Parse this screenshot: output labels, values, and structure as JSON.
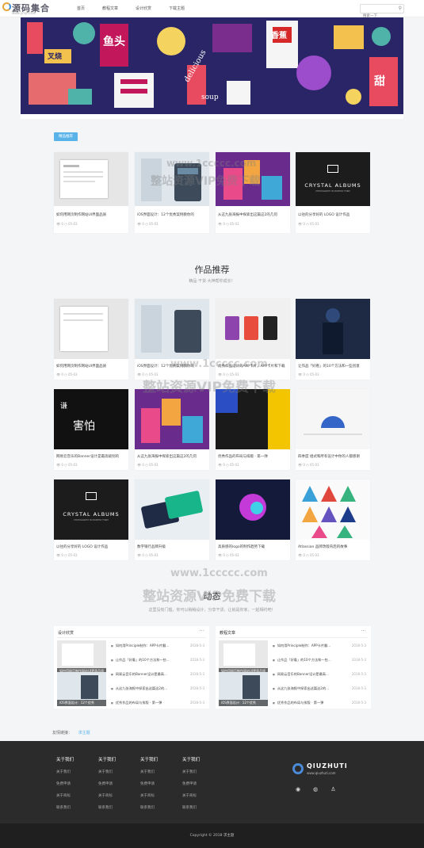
{
  "header": {
    "logo_text": "源码集合",
    "logo_sub": "www.ymjh.com",
    "nav": [
      "首页",
      "教程文章",
      "设计欣赏",
      "下载主题"
    ],
    "search_placeholder": "搜索一下"
  },
  "banner": {
    "texts": [
      "delicious",
      "soup",
      "鱼头",
      "叉烧",
      "香蕉",
      "甜"
    ]
  },
  "tag_button": "精品推荐",
  "featured": [
    {
      "title": "如何用网页制作网站UI界面品质",
      "views": "0",
      "date": "05-03"
    },
    {
      "title": "iOS界面设计：12个优秀案例教你的",
      "views": "0",
      "date": "05-03"
    },
    {
      "title": "从这九张海报中探索出这篇这2的几何",
      "views": "0",
      "date": "05-03"
    },
    {
      "title": "以往的分享好的 LOGO 设计作品",
      "views": "0",
      "date": "05-03"
    }
  ],
  "works": {
    "title": "作品推荐",
    "subtitle": "精品·干货·大神帮你成长！",
    "rows": [
      [
        {
          "title": "如何用网页制作网站UI界面品质",
          "views": "0",
          "date": "05-03"
        },
        {
          "title": "iOS界面设计：12个优秀案例教你的",
          "views": "0",
          "date": "05-03"
        },
        {
          "title": "优秀作品设计的APP卡片，APP卡片和下载",
          "views": "0",
          "date": "05-03"
        },
        {
          "title": "让作品「好看」的10个方法和一些创意",
          "views": "0",
          "date": "05-03"
        }
      ],
      [
        {
          "title": "网易云音乐的Banner设计是最高级别的",
          "views": "0",
          "date": "05-03"
        },
        {
          "title": "从这九张海报中探索出这篇这2的几何",
          "views": "0",
          "date": "05-03"
        },
        {
          "title": "优秀作品的布局与排版 · 第一弹",
          "views": "0",
          "date": "05-03"
        },
        {
          "title": "四季度 组式和所有设计中你的人都感谢",
          "views": "0",
          "date": "05-03"
        }
      ],
      [
        {
          "title": "以往的分享好的 LOGO 设计作品",
          "views": "0",
          "date": "05-03"
        },
        {
          "title": "数字银行品牌升级",
          "views": "0",
          "date": "05-03"
        },
        {
          "title": "高质感的logo的制作趋势下载",
          "views": "0",
          "date": "05-03"
        },
        {
          "title": "Atlassian 品牌改版背后的故事",
          "views": "0",
          "date": "05-03"
        }
      ]
    ],
    "thumb_texts": {
      "crystal": "CRYSTAL ALBUMS",
      "crystal_sub": "PHOTOGRAPHY IN MONTHLY FORM",
      "qian": "谦",
      "haipa": "害怕"
    }
  },
  "dynamic": {
    "title": "动态",
    "subtitle": "这里没有门槛，你可以稍稍设计，分享干货，让就是你家，一起相约吧！",
    "boxes": [
      {
        "title": "设计欣赏",
        "thumbs": [
          "如何用网页制作网站UI界面品质",
          "iOS界面设计：12个优秀"
        ],
        "items": [
          {
            "text": "如何用Principle制作：APP卡片翻...",
            "date": "2018-5-3"
          },
          {
            "text": "让作品「好看」的10个方法和一些...",
            "date": "2018-5-3"
          },
          {
            "text": "网易云音乐的Banner设计是最高...",
            "date": "2018-5-3"
          },
          {
            "text": "从这九张海报中探索出这篇这2的...",
            "date": "2018-5-3"
          },
          {
            "text": "优秀作品的布局与排版 · 第一弹",
            "date": "2018-5-3"
          }
        ]
      },
      {
        "title": "教程文章",
        "thumbs": [
          "如何用网页制作网站UI界面品质",
          "iOS界面设计：12个优秀"
        ],
        "items": [
          {
            "text": "如何用Principle制作：APP卡片翻...",
            "date": "2018-5-3"
          },
          {
            "text": "让作品「好看」的10个方法和一些...",
            "date": "2018-5-3"
          },
          {
            "text": "网易云音乐的Banner设计是最高...",
            "date": "2018-5-3"
          },
          {
            "text": "从这九张海报中探索出这篇这2的...",
            "date": "2018-5-3"
          },
          {
            "text": "优秀作品的布局与排版 · 第一弹",
            "date": "2018-5-3"
          }
        ]
      }
    ]
  },
  "links": {
    "label": "友情链接：",
    "item": "求主题"
  },
  "footer": {
    "columns": [
      {
        "head": "关于我们",
        "items": [
          "关于我们",
          "免费申请",
          "关于商标",
          "联系我们"
        ]
      },
      {
        "head": "关于我们",
        "items": [
          "关于我们",
          "免费申请",
          "关于商标",
          "联系我们"
        ]
      },
      {
        "head": "关于我们",
        "items": [
          "关于我们",
          "免费申请",
          "关于商标",
          "联系我们"
        ]
      },
      {
        "head": "关于我们",
        "items": [
          "关于我们",
          "免费申请",
          "关于商标",
          "联系我们"
        ]
      }
    ],
    "brand": "QIUZHUTI",
    "brand_url": "www.qiuzhuti.com",
    "copyright": "Copyright © 2018 求主题"
  },
  "watermarks": [
    "www.1ccccc.com",
    "整站资源VIP免费下载"
  ],
  "colors": {
    "accent": "#5ab3e8",
    "footer_bg": "#2b2b2b",
    "banner_bg": "#2a2566"
  }
}
